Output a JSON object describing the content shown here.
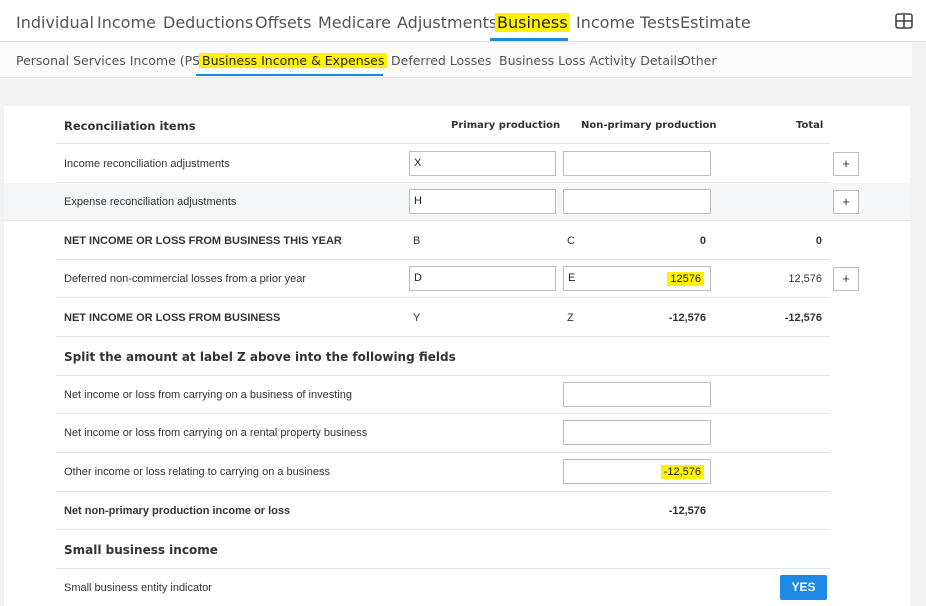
{
  "topnav": {
    "tabs": [
      "Individual",
      "Income",
      "Deductions",
      "Offsets",
      "Medicare",
      "Adjustments",
      "Business",
      "Income Tests",
      "Estimate"
    ],
    "active": "Business",
    "layout_icon": "grid-layout-icon"
  },
  "subnav": {
    "tabs": [
      "Personal Services Income (PSI)",
      "Business Income & Expenses",
      "Deferred Losses",
      "Business Loss Activity Details",
      "Other"
    ],
    "active": "Business Income & Expenses"
  },
  "table": {
    "headers": {
      "section": "Reconciliation items",
      "primary": "Primary production",
      "nonprimary": "Non-primary production",
      "total": "Total"
    },
    "income_recon": {
      "label": "Income reconciliation adjustments",
      "primary_code": "X",
      "primary_value": "",
      "nonprimary_value": "",
      "plus": "+"
    },
    "expense_recon": {
      "label": "Expense reconciliation adjustments",
      "primary_code": "H",
      "primary_value": "",
      "nonprimary_value": "",
      "plus": "+"
    },
    "net_this_year": {
      "label": "NET INCOME OR LOSS FROM BUSINESS THIS YEAR",
      "primary_code": "B",
      "nonprimary_code": "C",
      "nonprimary_value": "0",
      "total": "0"
    },
    "deferred": {
      "label": "Deferred non-commercial losses from a prior year",
      "primary_code": "D",
      "nonprimary_code": "E",
      "nonprimary_value": "12576",
      "total": "12,576",
      "plus": "+"
    },
    "net_business": {
      "label": "NET INCOME OR LOSS FROM BUSINESS",
      "primary_code": "Y",
      "nonprimary_code": "Z",
      "nonprimary_value": "-12,576",
      "total": "-12,576"
    },
    "split_section": "Split the amount at label Z above into the following fields",
    "investing": {
      "label": "Net income or loss from carrying on a business of investing",
      "value": ""
    },
    "rental": {
      "label": "Net income or loss from carrying on a rental property business",
      "value": ""
    },
    "other_income": {
      "label": "Other income or loss relating to carrying on a business",
      "value": "-12,576"
    },
    "net_nonprimary": {
      "label": "Net non-primary production income or loss",
      "value": "-12,576"
    },
    "small_business_section": "Small business income",
    "small_business_indicator": {
      "label": "Small business entity indicator",
      "button": "YES"
    }
  },
  "colors": {
    "accent": "#1e88e5",
    "highlight": "#fff200"
  }
}
